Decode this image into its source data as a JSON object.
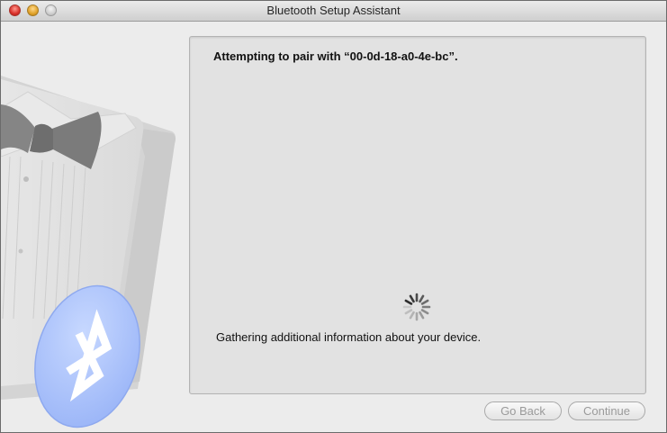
{
  "window": {
    "title": "Bluetooth Setup Assistant"
  },
  "main": {
    "heading": "Attempting to pair with “00-0d-18-a0-4e-bc”.",
    "status": "Gathering additional information about your device."
  },
  "footer": {
    "back_label": "Go Back",
    "continue_label": "Continue"
  },
  "icons": {
    "close": "close-icon",
    "minimize": "minimize-icon",
    "zoom": "zoom-icon",
    "spinner": "progress-spinner-icon",
    "bluetooth": "bluetooth-icon",
    "tuxedo": "tuxedo-illustration"
  },
  "colors": {
    "bluetooth_badge": "#a9c2fb",
    "close_light": "#e0443b",
    "minimize_light": "#e7a72e",
    "zoom_light": "#c4c4c4"
  }
}
